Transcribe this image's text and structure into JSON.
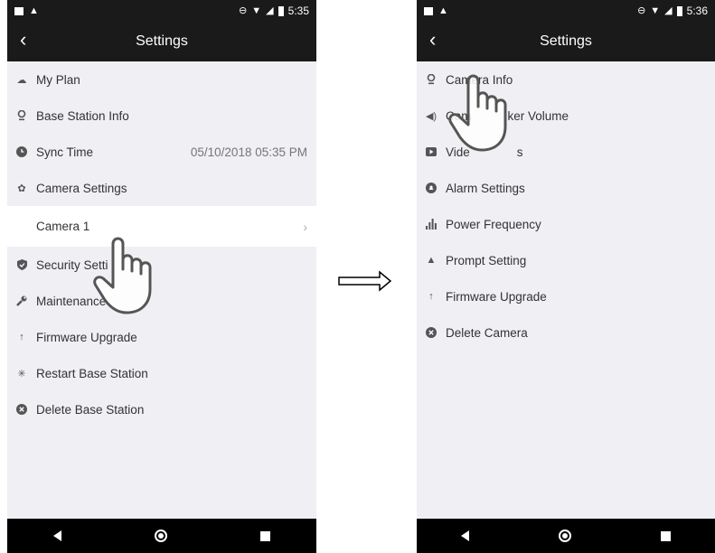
{
  "left": {
    "status": {
      "time": "5:35"
    },
    "header": {
      "title": "Settings"
    },
    "items": [
      {
        "label": "My Plan",
        "icon": "cloud-icon"
      },
      {
        "label": "Base Station Info",
        "icon": "location-pin-icon"
      },
      {
        "label": "Sync Time",
        "icon": "clock-icon",
        "value": "05/10/2018 05:35 PM"
      },
      {
        "label": "Camera Settings",
        "icon": "gear-icon"
      },
      {
        "label": "Camera 1",
        "icon": "chevron-right-icon"
      },
      {
        "label": "Security Setti",
        "icon": "shield-icon"
      },
      {
        "label": "Maintenance",
        "icon": "wrench-icon"
      },
      {
        "label": "Firmware Upgrade",
        "icon": "arrow-up-icon"
      },
      {
        "label": "Restart Base Station",
        "icon": "spinner-icon"
      },
      {
        "label": "Delete Base Station",
        "icon": "delete-circle-icon"
      }
    ]
  },
  "right": {
    "status": {
      "time": "5:36"
    },
    "header": {
      "title": "Settings"
    },
    "items": [
      {
        "label": "Camera Info",
        "icon": "location-pin-icon"
      },
      {
        "label_a": "Cam",
        "label_b": "ker Volume",
        "icon": "speaker-icon"
      },
      {
        "label_a": "Vide",
        "label_b": "s",
        "icon": "video-icon"
      },
      {
        "label": "Alarm Settings",
        "icon": "alarm-icon"
      },
      {
        "label": "Power Frequency",
        "icon": "bars-icon"
      },
      {
        "label": "Prompt Setting",
        "icon": "warning-icon"
      },
      {
        "label": "Firmware Upgrade",
        "icon": "arrow-up-icon"
      },
      {
        "label": "Delete Camera",
        "icon": "delete-circle-icon"
      }
    ]
  },
  "colors": {
    "bar": "#1a1a1a",
    "list_bg": "#efeff4",
    "selected_row": "#ffffff"
  }
}
